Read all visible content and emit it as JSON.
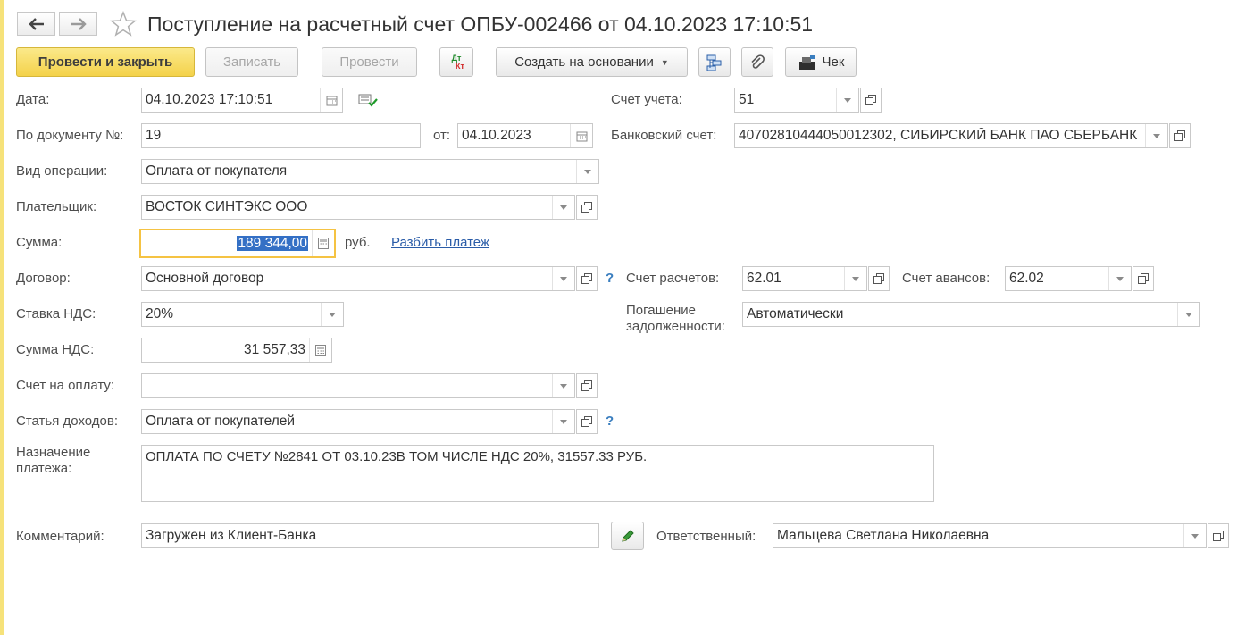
{
  "title": "Поступление на расчетный счет ОПБУ-002466 от 04.10.2023 17:10:51",
  "toolbar": {
    "post_close": "Провести и закрыть",
    "save": "Записать",
    "post": "Провести",
    "dtkt_dt": "Дт",
    "dtkt_kt": "Кт",
    "create_based": "Создать на основании",
    "check": "Чек"
  },
  "form": {
    "date_label": "Дата:",
    "date_value": "04.10.2023 17:10:51",
    "doc_num_label": "По документу №:",
    "doc_num_value": "19",
    "from_label": "от:",
    "from_value": "04.10.2023",
    "operation_label": "Вид операции:",
    "operation_value": "Оплата от покупателя",
    "payer_label": "Плательщик:",
    "payer_value": "ВОСТОК СИНТЭКС ООО",
    "sum_label": "Сумма:",
    "sum_value": "189 344,00",
    "currency": "руб.",
    "split_link": "Разбить платеж",
    "contract_label": "Договор:",
    "contract_value": "Основной договор",
    "vat_rate_label": "Ставка НДС:",
    "vat_rate_value": "20%",
    "vat_sum_label": "Сумма НДС:",
    "vat_sum_value": "31 557,33",
    "invoice_label": "Счет на оплату:",
    "invoice_value": "",
    "income_label": "Статья доходов:",
    "income_value": "Оплата от покупателей",
    "purpose_label_1": "Назначение",
    "purpose_label_2": "платежа:",
    "purpose_value": "ОПЛАТА ПО СЧЕТУ №2841 ОТ 03.10.23В ТОМ ЧИСЛЕ НДС 20%, 31557.33 РУБ.",
    "comment_label": "Комментарий:",
    "comment_value": "Загружен из Клиент-Банка",
    "account_label": "Счет учета:",
    "account_value": "51",
    "bank_label": "Банковский счет:",
    "bank_value": "40702810444050012302, СИБИРСКИЙ БАНК ПАО СБЕРБАНК",
    "settle_label": "Счет расчетов:",
    "settle_value": "62.01",
    "advance_label": "Счет авансов:",
    "advance_value": "62.02",
    "repay_label_1": "Погашение",
    "repay_label_2": "задолженности:",
    "repay_value": "Автоматически",
    "responsible_label": "Ответственный:",
    "responsible_value": "Мальцева Светлана Николаевна",
    "help_mark": "?"
  },
  "colors": {
    "primary_button": "#f4d24a",
    "link": "#2a5ca8",
    "focus_border": "#f5c343",
    "selection": "#3470c5"
  }
}
